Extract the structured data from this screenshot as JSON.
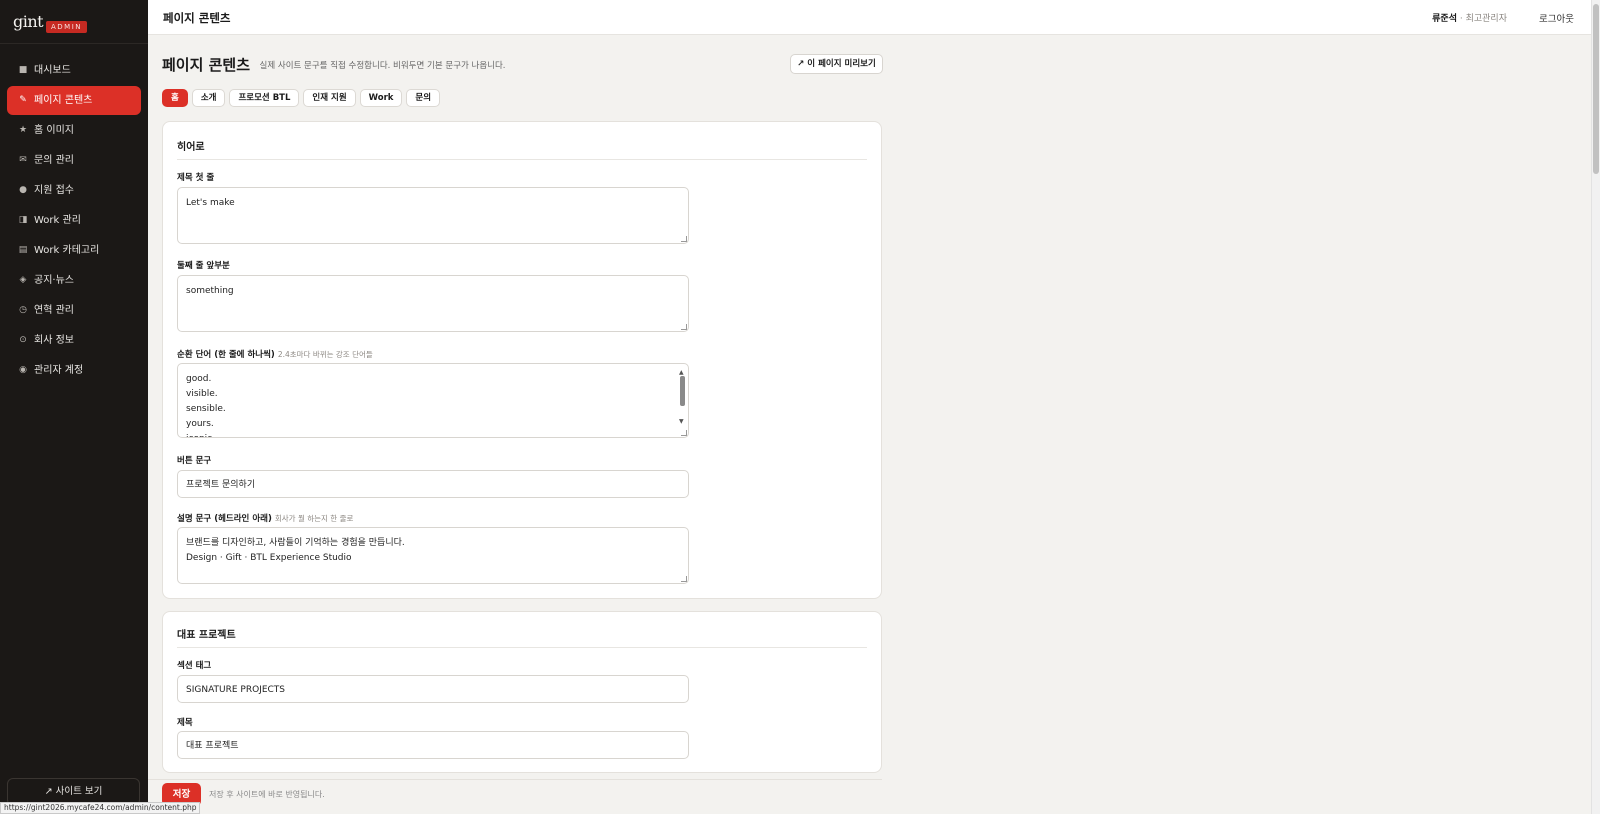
{
  "sidebar": {
    "brand": "gint",
    "badge": "ADMIN",
    "items": [
      {
        "label": "대시보드",
        "icon": "■"
      },
      {
        "label": "페이지 콘텐츠",
        "icon": "✎"
      },
      {
        "label": "홈 이미지",
        "icon": "★"
      },
      {
        "label": "문의 관리",
        "icon": "✉"
      },
      {
        "label": "지원 접수",
        "icon": "●"
      },
      {
        "label": "Work 관리",
        "icon": "◨"
      },
      {
        "label": "Work 카테고리",
        "icon": "▤"
      },
      {
        "label": "공지·뉴스",
        "icon": "◈"
      },
      {
        "label": "연혁 관리",
        "icon": "◷"
      },
      {
        "label": "회사 정보",
        "icon": "⊙"
      },
      {
        "label": "관리자 계정",
        "icon": "◉"
      }
    ],
    "site_view": "↗ 사이트 보기"
  },
  "topbar": {
    "title": "페이지 콘텐츠",
    "user_name": "류준석",
    "user_sep": " · ",
    "user_role": "최고관리자",
    "logout": "로그아웃"
  },
  "page": {
    "title": "페이지 콘텐츠",
    "description": "실제 사이트 문구를 직접 수정합니다. 비워두면 기본 문구가 나옵니다.",
    "preview_button": "↗ 이 페이지 미리보기",
    "tabs": [
      "홈",
      "소개",
      "프로모션 BTL",
      "인재 지원",
      "Work",
      "문의"
    ]
  },
  "hero": {
    "heading": "히어로",
    "title_first_label": "제목 첫 줄",
    "title_first_value": "Let's make",
    "second_line_label": "둘째 줄 앞부분",
    "second_line_value": "something",
    "rotating_label": "순환 단어 (한 줄에 하나씩)",
    "rotating_hint": "2.4초마다 바뀌는 강조 단어들",
    "rotating_value": "good.\nvisible.\nsensible.\nyours.\niconic.",
    "button_label": "버튼 문구",
    "button_value": "프로젝트 문의하기",
    "desc_label": "설명 문구 (헤드라인 아래)",
    "desc_hint": "회사가 뭘 하는지 한 줄로",
    "desc_value": "브랜드를 디자인하고, 사람들이 기억하는 경험을 만듭니다.\nDesign · Gift · BTL Experience Studio"
  },
  "projects": {
    "heading": "대표 프로젝트",
    "section_tag_label": "섹션 태그",
    "section_tag_value": "SIGNATURE PROJECTS",
    "title_label": "제목",
    "title_value": "대표 프로젝트"
  },
  "save": {
    "button": "저장",
    "note": "저장 후 사이트에 바로 반영됩니다."
  },
  "status_url": "https://gint2026.mycafe24.com/admin/content.php",
  "colors": {
    "accent": "#dc3027",
    "sidebar_bg": "#1b1816",
    "page_bg": "#f3f2ef"
  }
}
